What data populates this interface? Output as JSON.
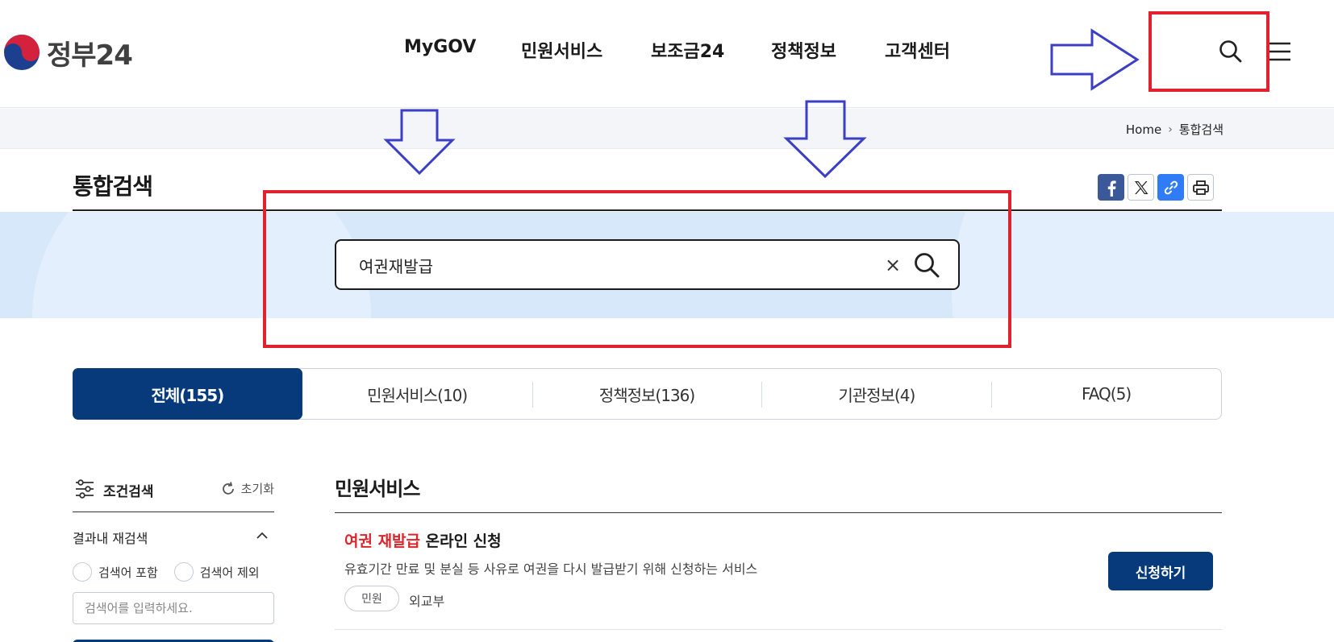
{
  "header": {
    "logo_text": "정부24",
    "nav": [
      {
        "label": "MyGOV"
      },
      {
        "label": "민원서비스"
      },
      {
        "label": "보조금24"
      },
      {
        "label": "정책정보"
      },
      {
        "label": "고객센터"
      }
    ],
    "search_icon": "search-icon",
    "menu_icon": "hamburger-menu-icon"
  },
  "breadcrumb": {
    "home": "Home",
    "current": "통합검색"
  },
  "page": {
    "title": "통합검색",
    "share_icons": [
      "facebook-icon",
      "x-icon",
      "link-icon",
      "print-icon"
    ]
  },
  "search": {
    "value": "여권재발급",
    "clear_label": "×"
  },
  "tabs": [
    {
      "label": "전체(155)",
      "active": true
    },
    {
      "label": "민원서비스(10)"
    },
    {
      "label": "정책정보(136)"
    },
    {
      "label": "기관정보(4)"
    },
    {
      "label": "FAQ(5)"
    }
  ],
  "filter": {
    "title": "조건검색",
    "reset": "초기화",
    "refine_label": "결과내 재검색",
    "include": "검색어 포함",
    "exclude": "검색어 제외",
    "input_placeholder": "검색어를 입력하세요."
  },
  "results": {
    "section_title": "민원서비스",
    "items": [
      {
        "title_highlight": "여권 재발급",
        "title_rest": " 온라인 신청",
        "description": "유효기간 만료 및 분실 등 사유로 여권을 다시 발급받기 위해 신청하는 서비스",
        "tag": "민원",
        "agency": "외교부",
        "action": "신청하기"
      }
    ]
  },
  "colors": {
    "primary": "#063a7a",
    "highlight": "#d9262c",
    "annotation_box": "#e0212e",
    "annotation_arrow": "#3b3fc4"
  }
}
